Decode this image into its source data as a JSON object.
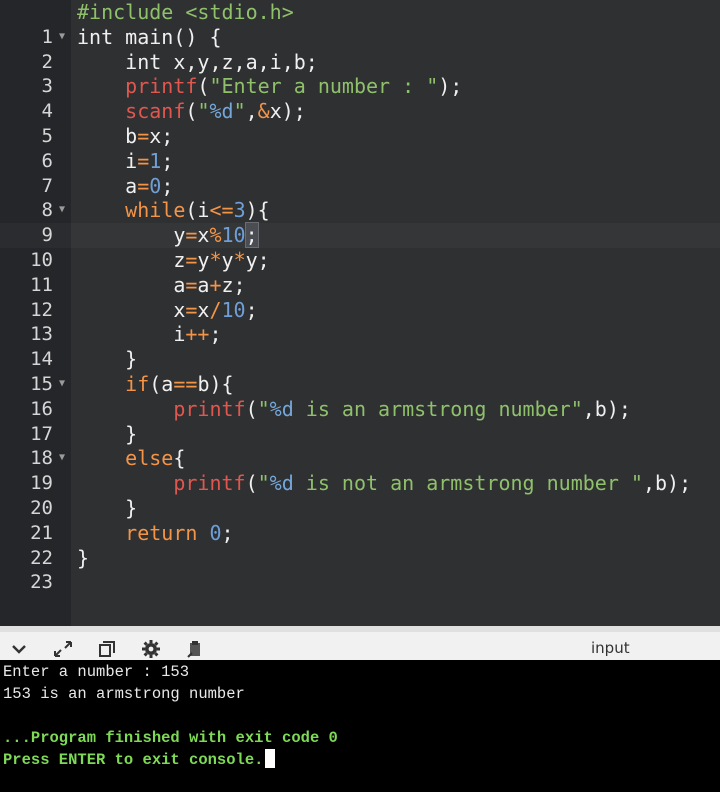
{
  "editor": {
    "lines": [
      {
        "n": "1"
      },
      {
        "n": "2"
      },
      {
        "n": "3"
      },
      {
        "n": "4"
      },
      {
        "n": "5"
      },
      {
        "n": "6"
      },
      {
        "n": "7"
      },
      {
        "n": "8"
      },
      {
        "n": "9"
      },
      {
        "n": "10"
      },
      {
        "n": "11"
      },
      {
        "n": "12"
      },
      {
        "n": "13"
      },
      {
        "n": "14"
      },
      {
        "n": "15"
      },
      {
        "n": "16"
      },
      {
        "n": "17"
      },
      {
        "n": "18"
      },
      {
        "n": "19"
      },
      {
        "n": "20"
      },
      {
        "n": "21"
      },
      {
        "n": "22"
      },
      {
        "n": "23"
      }
    ],
    "code": {
      "l1a": "#include ",
      "l1b": "<stdio.h>",
      "l2": "int main() {",
      "l3": "    int x,y,z,a,i,b;",
      "l4a": "printf",
      "l4b": "(",
      "l4c": "\"Enter a number : \"",
      "l4d": ");",
      "l5a": "scanf",
      "l5b": "(",
      "l5c": "\"",
      "l5d": "%d",
      "l5e": "\"",
      "l5f": ",",
      "l5g": "&",
      "l5h": "x);",
      "l6a": "b",
      "l6b": "=",
      "l6c": "x;",
      "l7a": "i",
      "l7b": "=",
      "l7c": "1",
      "l7d": ";",
      "l8a": "a",
      "l8b": "=",
      "l8c": "0",
      "l8d": ";",
      "l9a": "while",
      "l9b": "(i",
      "l9c": "<=",
      "l9d": "3",
      "l9e": "){",
      "l10a": "y",
      "l10b": "=",
      "l10c": "x",
      "l10d": "%",
      "l10e": "10",
      "l10f": ";",
      "l11a": "z",
      "l11b": "=",
      "l11c": "y",
      "l11d": "*",
      "l11e": "y",
      "l11f": "*",
      "l11g": "y;",
      "l12a": "a",
      "l12b": "=",
      "l12c": "a",
      "l12d": "+",
      "l12e": "z;",
      "l13a": "x",
      "l13b": "=",
      "l13c": "x",
      "l13d": "/",
      "l13e": "10",
      "l13f": ";",
      "l14a": "i",
      "l14b": "++",
      "l14c": ";",
      "l15": "}",
      "l16a": "if",
      "l16b": "(a",
      "l16c": "==",
      "l16d": "b){",
      "l17a": "printf",
      "l17b": "(",
      "l17c": "\"",
      "l17d": "%d",
      "l17e": " is an armstrong number\"",
      "l17f": ",b);",
      "l18": "}",
      "l19a": "else",
      "l19b": "{",
      "l20a": "printf",
      "l20b": "(",
      "l20c": "\"",
      "l20d": "%d",
      "l20e": " is not an armstrong number \"",
      "l20f": ",b);",
      "l21": "}",
      "l22a": "return ",
      "l22b": "0",
      "l22c": ";",
      "l23": "}"
    }
  },
  "toolbar": {
    "collapse_icon": "chevron-down-icon",
    "expand_icon": "expand-arrows-icon",
    "copy_icon": "copy-panel-icon",
    "settings_icon": "gear-icon",
    "clear_icon": "clipboard-icon",
    "input_label": "input"
  },
  "console": {
    "line1": "Enter a number : 153",
    "line2": "153 is an armstrong number",
    "line3": "...Program finished with exit code 0",
    "line4": "Press ENTER to exit console."
  }
}
